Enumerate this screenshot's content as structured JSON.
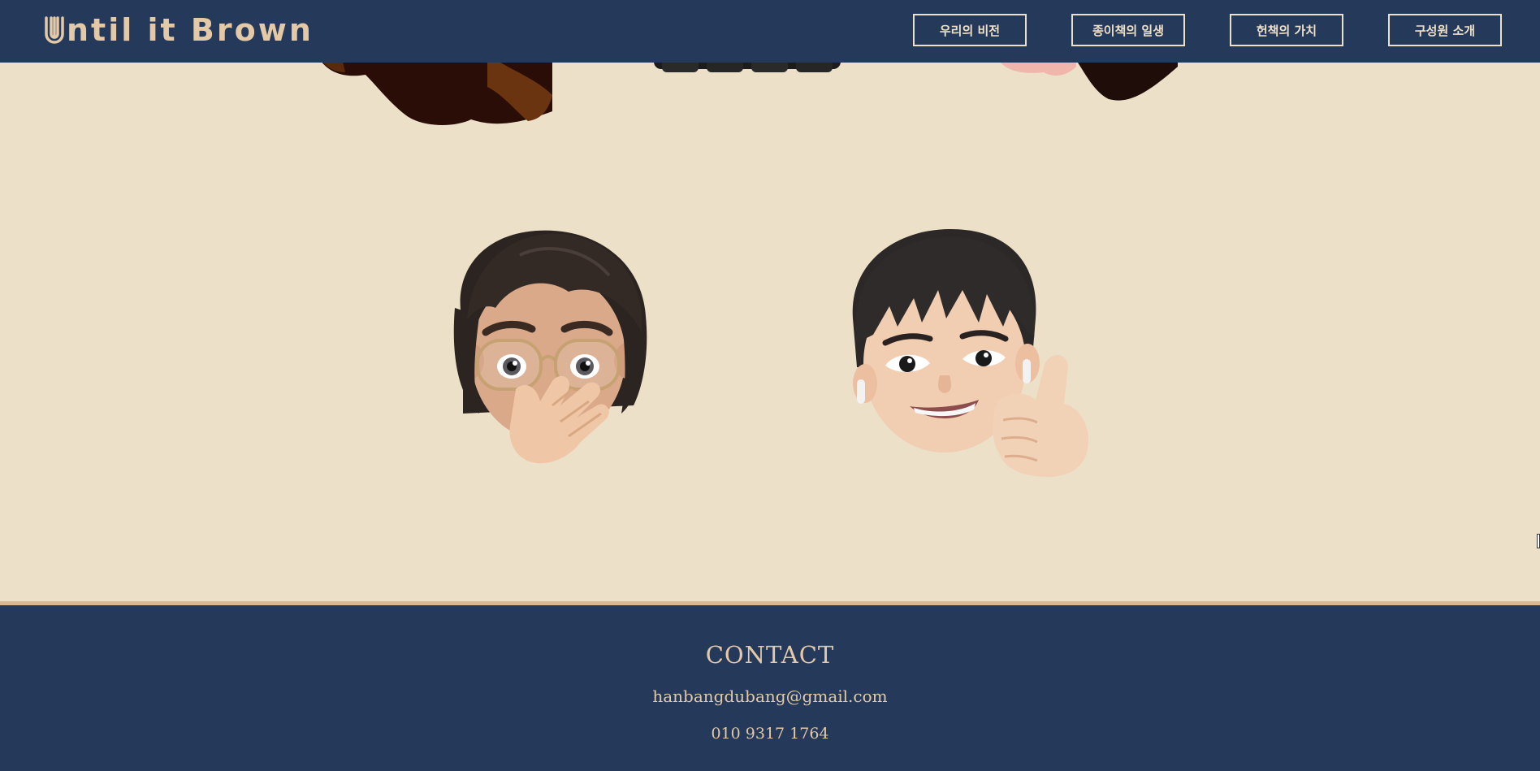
{
  "brand": {
    "logo_text": "ntil it Brown",
    "logo_full": "Until it Brown"
  },
  "nav": {
    "items": [
      {
        "label": "우리의 비전"
      },
      {
        "label": "종이책의 일생"
      },
      {
        "label": "헌책의 가치"
      },
      {
        "label": "구성원 소개"
      }
    ]
  },
  "footer": {
    "title": "CONTACT",
    "email": "hanbangdubang@gmail.com",
    "phone": "010 9317 1764"
  },
  "colors": {
    "navy": "#25395a",
    "beige": "#ede0c9",
    "tan_text": "#e3c9a8",
    "divider": "#d8b795"
  },
  "icons": [
    "logo-u-mark-icon",
    "memoji-avatar-glasses",
    "memoji-avatar-thumbs-up"
  ]
}
